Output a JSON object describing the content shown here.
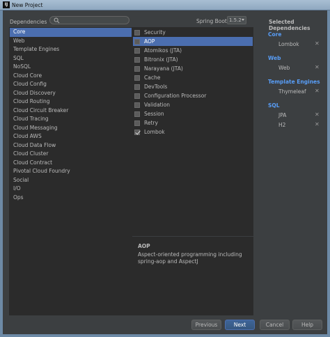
{
  "window": {
    "title": "New Project",
    "icon_text": "IJ"
  },
  "header": {
    "dependencies_label": "Dependencies",
    "search": {
      "value": "",
      "placeholder": ""
    },
    "spring_boot_label": "Spring Boot",
    "spring_boot_version": "1.5.2"
  },
  "categories": [
    "Core",
    "Web",
    "Template Engines",
    "SQL",
    "NoSQL",
    "Cloud Core",
    "Cloud Config",
    "Cloud Discovery",
    "Cloud Routing",
    "Cloud Circuit Breaker",
    "Cloud Tracing",
    "Cloud Messaging",
    "Cloud AWS",
    "Cloud Data Flow",
    "Cloud Cluster",
    "Cloud Contract",
    "Pivotal Cloud Foundry",
    "Social",
    "I/O",
    "Ops"
  ],
  "selected_category": "Core",
  "dependencies": [
    {
      "label": "Security",
      "checked": false
    },
    {
      "label": "AOP",
      "checked": false,
      "active": true
    },
    {
      "label": "Atomikos (JTA)",
      "checked": false
    },
    {
      "label": "Bitronix (JTA)",
      "checked": false
    },
    {
      "label": "Narayana (JTA)",
      "checked": false
    },
    {
      "label": "Cache",
      "checked": false
    },
    {
      "label": "DevTools",
      "checked": false
    },
    {
      "label": "Configuration Processor",
      "checked": false
    },
    {
      "label": "Validation",
      "checked": false
    },
    {
      "label": "Session",
      "checked": false
    },
    {
      "label": "Retry",
      "checked": false
    },
    {
      "label": "Lombok",
      "checked": true
    }
  ],
  "description": {
    "title": "AOP",
    "text": "Aspect-oriented programming including spring-aop and AspectJ"
  },
  "selected": {
    "header": "Selected Dependencies",
    "groups": [
      {
        "title": "Core",
        "items": [
          "Lombok"
        ]
      },
      {
        "title": "Web",
        "items": [
          "Web"
        ]
      },
      {
        "title": "Template Engines",
        "items": [
          "Thymeleaf"
        ]
      },
      {
        "title": "SQL",
        "items": [
          "JPA",
          "H2"
        ]
      }
    ],
    "remove_glyph": "✕"
  },
  "buttons": {
    "previous": "Previous",
    "next": "Next",
    "cancel": "Cancel",
    "help": "Help"
  },
  "colors": {
    "accent": "#4b6eaf",
    "group_title": "#589df6",
    "background": "#3c3f41",
    "list_background": "#2b2b2b"
  }
}
